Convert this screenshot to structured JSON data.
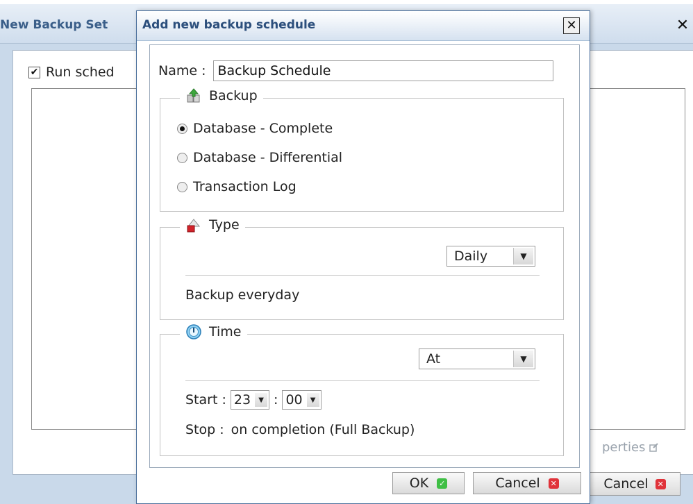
{
  "background_window": {
    "title": "New Backup Set",
    "run_label": "Run sched",
    "properties_label": "perties",
    "cancel_label": "Cancel"
  },
  "dialog": {
    "title": "Add new backup schedule",
    "name_label": "Name :",
    "name_value": "Backup Schedule",
    "backup_group": {
      "label": "Backup",
      "options": [
        {
          "label": "Database - Complete",
          "selected": true
        },
        {
          "label": "Database - Differential",
          "selected": false
        },
        {
          "label": "Transaction Log",
          "selected": false
        }
      ]
    },
    "type_group": {
      "label": "Type",
      "dropdown_value": "Daily",
      "description": "Backup everyday"
    },
    "time_group": {
      "label": "Time",
      "dropdown_value": "At",
      "start_label": "Start :",
      "start_hour": "23",
      "start_sep": ":",
      "start_minute": "00",
      "stop_label": "Stop :",
      "stop_value": "on completion (Full Backup)"
    },
    "ok_label": "OK",
    "cancel_label": "Cancel"
  },
  "icons": {
    "backup": "backup-icon",
    "type": "type-icon",
    "time": "clock-icon",
    "close": "close-icon",
    "ok": "check-icon",
    "cancel": "x-icon"
  }
}
